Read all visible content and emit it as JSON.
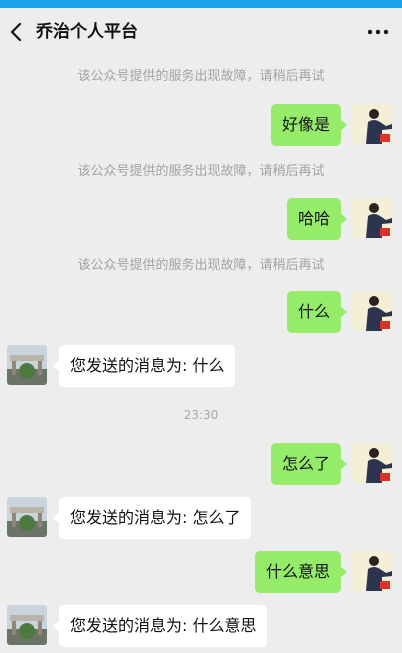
{
  "status_bar": {
    "carrier": "",
    "time": "",
    "right": ""
  },
  "header": {
    "title": "乔治个人平台"
  },
  "icons": {
    "back": "chevron-left-icon",
    "more": "more-horizontal-icon"
  },
  "messages": [
    {
      "type": "system",
      "text": "该公众号提供的服务出现故障，请稍后再试"
    },
    {
      "type": "me",
      "text": "好像是"
    },
    {
      "type": "system",
      "text": "该公众号提供的服务出现故障，请稍后再试"
    },
    {
      "type": "me",
      "text": "哈哈"
    },
    {
      "type": "system",
      "text": "该公众号提供的服务出现故障，请稍后再试"
    },
    {
      "type": "me",
      "text": "什么"
    },
    {
      "type": "them",
      "text": "您发送的消息为: 什么"
    },
    {
      "type": "time",
      "text": "23:30"
    },
    {
      "type": "me",
      "text": "怎么了"
    },
    {
      "type": "them",
      "text": "您发送的消息为: 怎么了"
    },
    {
      "type": "me",
      "text": "什么意思"
    },
    {
      "type": "them",
      "text": "您发送的消息为: 什么意思"
    }
  ],
  "colors": {
    "background": "#ededed",
    "my_bubble": "#95ec69",
    "their_bubble": "#ffffff",
    "status_bar": "#1aa3e8"
  }
}
